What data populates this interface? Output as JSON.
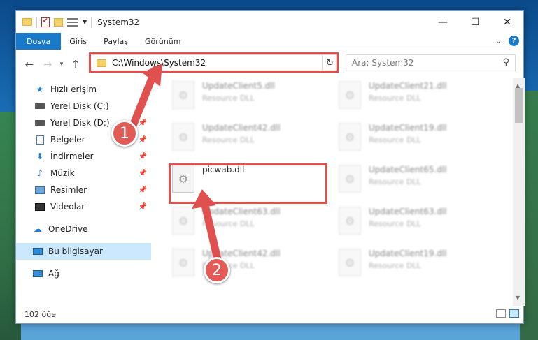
{
  "window": {
    "title": "System32",
    "minimize": "—",
    "maximize": "☐",
    "close": "✕"
  },
  "ribbon": {
    "tabs": [
      "Dosya",
      "Giriş",
      "Paylaş",
      "Görünüm"
    ],
    "help": "?"
  },
  "nav": {
    "back": "←",
    "forward": "→",
    "recent": "▾",
    "up": "↑",
    "address": "C:\\Windows\\System32",
    "refresh": "↻",
    "search_placeholder": "Ara: System32"
  },
  "sidebar": {
    "items": [
      {
        "label": "Hızlı erişim",
        "icon": "star-icon",
        "pinned": false
      },
      {
        "label": "Yerel Disk (C:)",
        "icon": "disk-icon",
        "pinned": true
      },
      {
        "label": "Yerel Disk (D:)",
        "icon": "disk-icon",
        "pinned": true
      },
      {
        "label": "Belgeler",
        "icon": "documents-icon",
        "pinned": true
      },
      {
        "label": "İndirmeler",
        "icon": "downloads-icon",
        "pinned": true
      },
      {
        "label": "Müzik",
        "icon": "music-icon",
        "pinned": true
      },
      {
        "label": "Resimler",
        "icon": "pictures-icon",
        "pinned": true
      },
      {
        "label": "Videolar",
        "icon": "videos-icon",
        "pinned": true
      },
      {
        "label": "OneDrive",
        "icon": "cloud-icon",
        "pinned": false
      },
      {
        "label": "Bu bilgisayar",
        "icon": "computer-icon",
        "pinned": false,
        "selected": true
      },
      {
        "label": "Ağ",
        "icon": "network-icon",
        "pinned": false
      }
    ]
  },
  "files": [
    {
      "name": "UpdateClient5.dll",
      "type": "Resource DLL",
      "blurred": true
    },
    {
      "name": "UpdateClient21.dll",
      "type": "Resource DLL",
      "blurred": true
    },
    {
      "name": "UpdateClient42.dll",
      "type": "Resource DLL",
      "blurred": true
    },
    {
      "name": "UpdateClient19.dll",
      "type": "Resource DLL",
      "blurred": true
    },
    {
      "name": "picwab.dll",
      "type": "",
      "blurred": false
    },
    {
      "name": "UpdateClient65.dll",
      "type": "Resource DLL",
      "blurred": true
    },
    {
      "name": "UpdateClient63.dll",
      "type": "Resource DLL",
      "blurred": true
    },
    {
      "name": "UpdateClient63.dll",
      "type": "Resource DLL",
      "blurred": true
    },
    {
      "name": "UpdateClient42.dll",
      "type": "Resource DLL",
      "blurred": true
    },
    {
      "name": "UpdateClient19.dll",
      "type": "Resource DLL",
      "blurred": true
    }
  ],
  "status": {
    "count": "102 öğe"
  },
  "annotations": {
    "step1": "1",
    "step2": "2",
    "color": "#e0504f"
  }
}
